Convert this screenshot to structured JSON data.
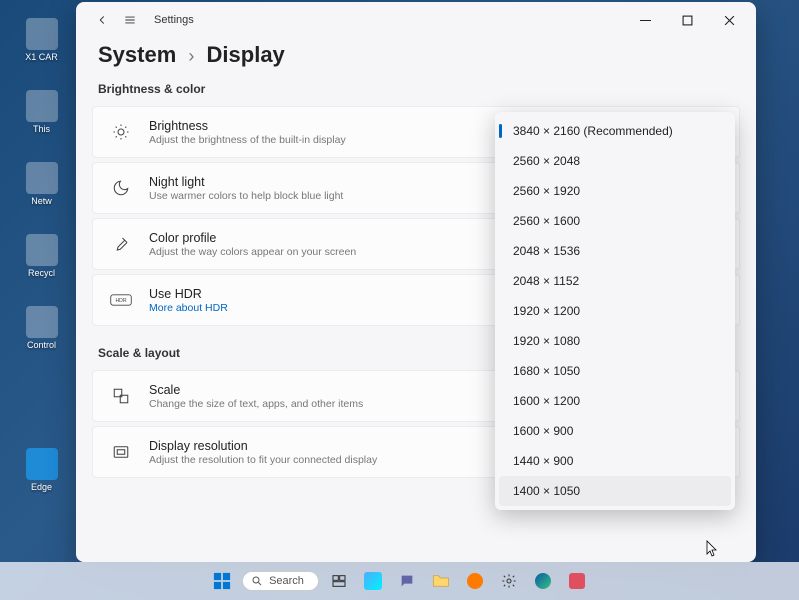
{
  "desktop": {
    "icons": [
      "X1 CAR",
      "This",
      "Netw",
      "Recycl",
      "Control",
      "Edge"
    ]
  },
  "window": {
    "app_name": "Settings",
    "breadcrumb": {
      "parent": "System",
      "current": "Display"
    },
    "sections": {
      "brightness_color": {
        "title": "Brightness & color",
        "brightness": {
          "title": "Brightness",
          "sub": "Adjust the brightness of the built-in display"
        },
        "night_light": {
          "title": "Night light",
          "sub": "Use warmer colors to help block blue light"
        },
        "color_profile": {
          "title": "Color profile",
          "sub": "Adjust the way colors appear on your screen"
        },
        "hdr": {
          "title": "Use HDR",
          "link": "More about HDR"
        }
      },
      "scale_layout": {
        "title": "Scale & layout",
        "scale": {
          "title": "Scale",
          "sub": "Change the size of text, apps, and other items"
        },
        "resolution": {
          "title": "Display resolution",
          "sub": "Adjust the resolution to fit your connected display"
        }
      }
    }
  },
  "resolution_options": [
    "3840 × 2160 (Recommended)",
    "2560 × 2048",
    "2560 × 1920",
    "2560 × 1600",
    "2048 × 1536",
    "2048 × 1152",
    "1920 × 1200",
    "1920 × 1080",
    "1680 × 1050",
    "1600 × 1200",
    "1600 × 900",
    "1440 × 900",
    "1400 × 1050"
  ],
  "resolution_selected_index": 0,
  "resolution_hover_index": 12,
  "taskbar": {
    "search_label": "Search"
  }
}
